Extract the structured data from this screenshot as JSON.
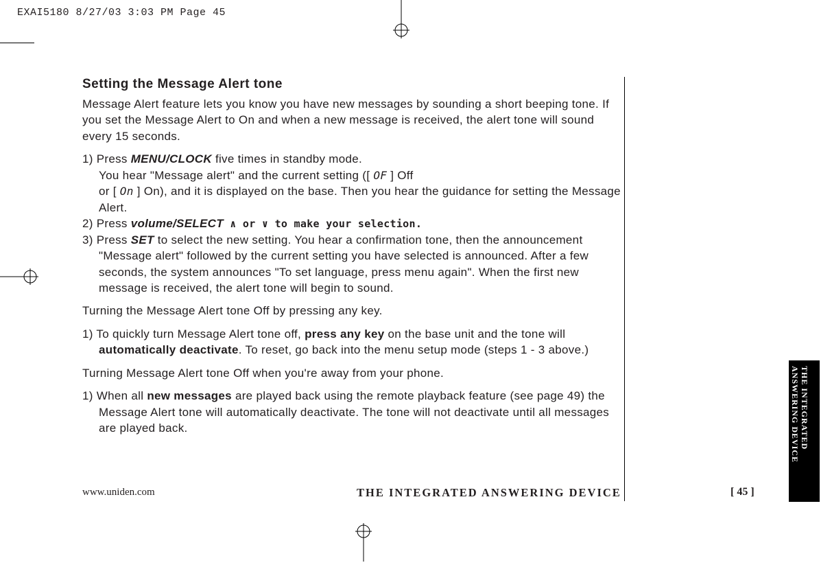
{
  "slug": "EXAI5180  8/27/03 3:03 PM  Page 45",
  "title": "Setting the Message Alert tone",
  "intro": "Message Alert feature lets you know you have new messages by sounding a short beeping tone. If you set the Message Alert to On and when a new message is received, the alert tone will sound every 15 seconds.",
  "step1_a": "1) Press ",
  "step1_menu": "MENU/CLOCK",
  "step1_b": " five times in standby mode.",
  "step1_c": "You hear \"Message alert\" and the current setting ([ ",
  "step1_off_seg": "OF",
  "step1_d": " ] Off",
  "step1_e": "or [ ",
  "step1_on_seg": "On",
  "step1_f": " ] On), and it is displayed on the base. Then you hear the guidance for setting the Message Alert.",
  "step2_a": "2) Press ",
  "step2_vol": "volume/SELECT",
  "step2_b": "  ∧  or  ∨  to make your selection.",
  "step3_a": "3) Press ",
  "step3_set": "SET",
  "step3_b": " to select the new setting. You hear a confirmation tone, then the announcement \"Message alert\" followed by the current setting you have selected is announced. After a few seconds, the system announces \"To set language, press menu again\". When the first new message is received, the alert tone will begin to sound.",
  "sub1": "Turning the Message Alert tone Off by pressing any key.",
  "sub1_step_a": "1) To quickly turn Message Alert tone off, ",
  "sub1_step_bold1": "press any key",
  "sub1_step_b": " on the base unit and the tone will ",
  "sub1_step_bold2": "automatically deactivate",
  "sub1_step_c": ". To reset, go back into the menu setup mode (steps 1 - 3 above.)",
  "sub2": "Turning Message Alert tone Off when you're away from your phone.",
  "sub2_step_a": "1) When all ",
  "sub2_step_bold": "new messages",
  "sub2_step_b": " are played back using the remote playback feature (see page 49) the Message Alert tone will automatically deactivate. The tone will not deactivate until all messages are played back.",
  "footer_url": "www.uniden.com",
  "footer_title": "THE INTEGRATED ANSWERING DEVICE",
  "footer_page": "[ 45 ]",
  "sidetab_line1": "THE INTEGRATED",
  "sidetab_line2": "ANSWERING DEVICE"
}
